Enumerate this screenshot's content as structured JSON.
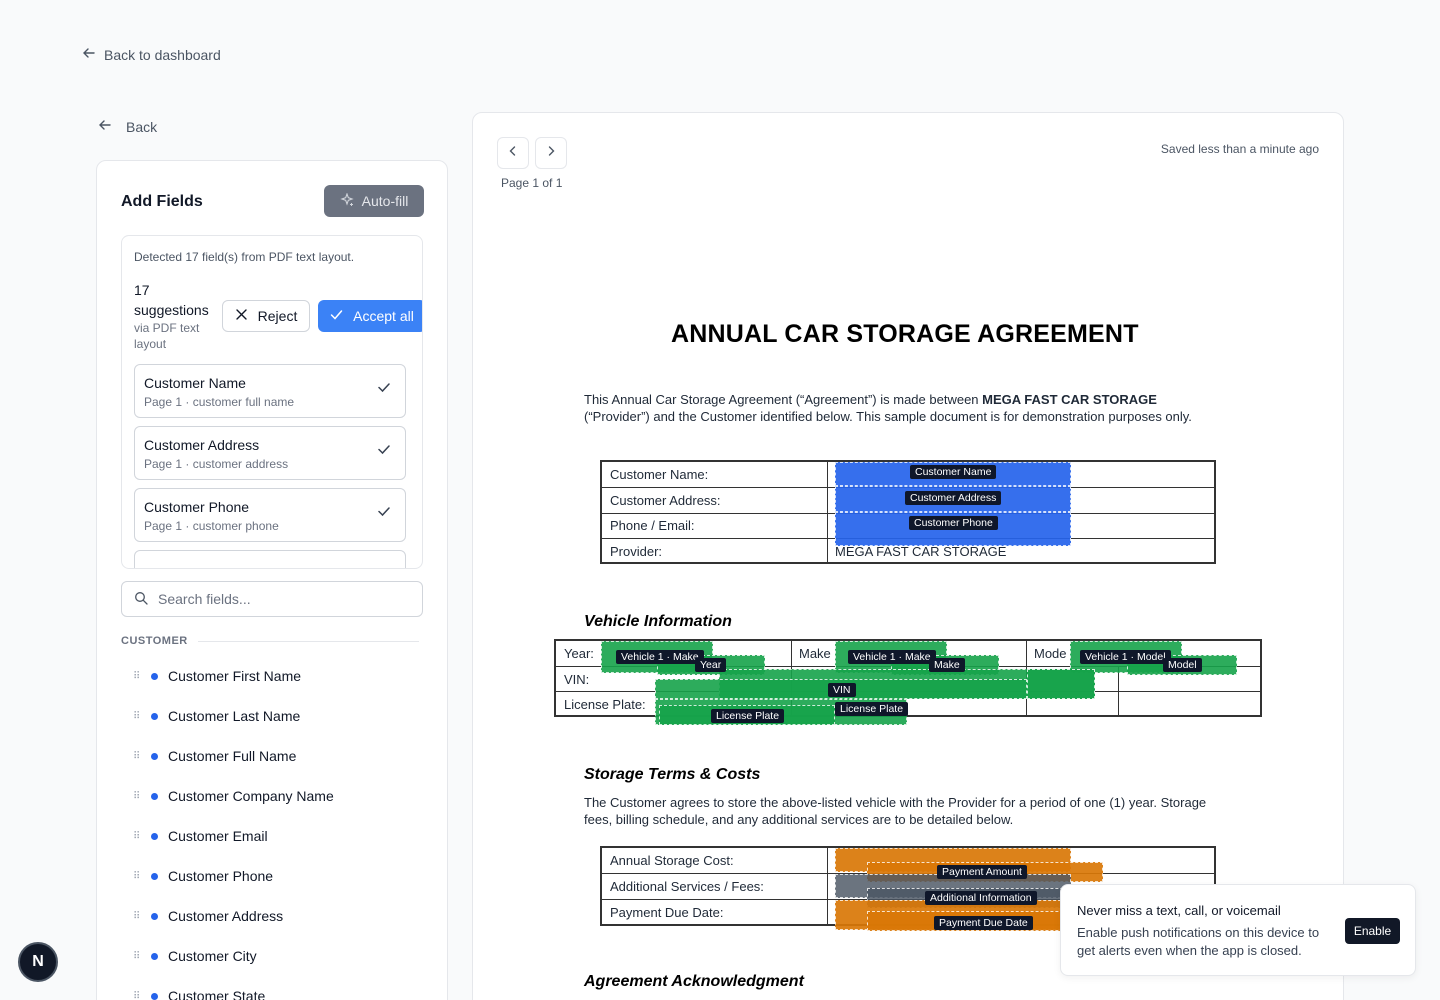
{
  "nav": {
    "back_to_dashboard": "Back to dashboard",
    "back": "Back"
  },
  "left": {
    "title": "Add Fields",
    "autofill_label": "Auto-fill",
    "suggestions": {
      "detected_text": "Detected 17 field(s) from PDF text layout.",
      "count_text": "17 suggestions",
      "source_text": "via PDF text layout",
      "reject_label": "Reject",
      "accept_label": "Accept all",
      "items": [
        {
          "name": "Customer Name",
          "sub": "Page 1 · customer full name"
        },
        {
          "name": "Customer Address",
          "sub": "Page 1 · customer address"
        },
        {
          "name": "Customer Phone",
          "sub": "Page 1 · customer phone"
        }
      ]
    },
    "search_placeholder": "Search fields...",
    "section_label": "CUSTOMER",
    "fields": [
      "Customer First Name",
      "Customer Last Name",
      "Customer Full Name",
      "Customer Company Name",
      "Customer Email",
      "Customer Phone",
      "Customer Address",
      "Customer City",
      "Customer State"
    ]
  },
  "viewer": {
    "page_label": "Page 1 of 1",
    "saved_text": "Saved less than a minute ago"
  },
  "document": {
    "title": "ANNUAL CAR STORAGE AGREEMENT",
    "intro_pre": "This Annual Car Storage Agreement (“Agreement”) is made between ",
    "intro_bold": "MEGA FAST CAR STORAGE",
    "intro_post": "(“Provider”) and the Customer identified below. This sample document is for demonstration purposes only.",
    "customer_rows": [
      "Customer Name:",
      "Customer Address:",
      "Phone / Email:",
      "Provider:"
    ],
    "provider_value": "MEGA FAST CAR STORAGE",
    "vehicle_heading": "Vehicle Information",
    "vehicle_labels": {
      "year": "Year:",
      "make": "Make",
      "model": "Mode",
      "vin": "VIN:",
      "plate": "License Plate:"
    },
    "storage_heading": "Storage Terms & Costs",
    "storage_text": "The Customer agrees to store the above-listed vehicle with the Provider for a period of one (1) year. Storage fees, billing schedule, and any additional services are to be detailed below.",
    "cost_rows": [
      "Annual Storage Cost:",
      "Additional Services / Fees:",
      "Payment Due Date:"
    ],
    "ack_heading": "Agreement Acknowledgment"
  },
  "overlay_tags": {
    "customer_name": "Customer Name",
    "customer_address": "Customer Address",
    "customer_phone": "Customer Phone",
    "vehicle_make_1": "Vehicle 1 · Make",
    "year": "Year",
    "vehicle_make_2": "Vehicle 1 · Make",
    "make": "Make",
    "vehicle_model": "Vehicle 1 · Model",
    "model": "Model",
    "vin": "VIN",
    "license_plate_1": "License Plate",
    "license_plate_2": "License Plate",
    "payment_amount": "Payment Amount",
    "additional_info": "Additional Information",
    "payment_due_date": "Payment Due Date"
  },
  "notification": {
    "title": "Never miss a text, call, or voicemail",
    "body": "Enable push notifications on this device to get alerts even when the app is closed.",
    "enable_label": "Enable"
  },
  "badge_letter": "N",
  "colors": {
    "accent": "#3b82f6",
    "field_blue": "#2563eb",
    "field_green": "#16a34a",
    "field_orange": "#d97706"
  }
}
